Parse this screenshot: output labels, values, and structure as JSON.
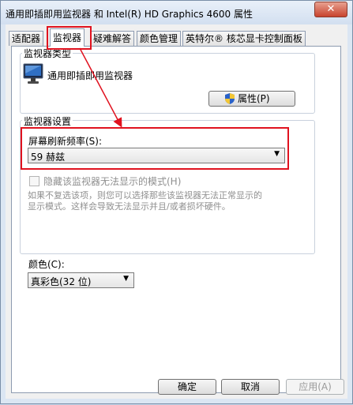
{
  "window": {
    "title": "通用即插即用监视器 和 Intel(R) HD Graphics 4600 属性",
    "close_glyph": "✕"
  },
  "tabs": [
    {
      "label": "适配器"
    },
    {
      "label": "监视器"
    },
    {
      "label": "疑难解答"
    },
    {
      "label": "颜色管理"
    },
    {
      "label": "英特尔® 核芯显卡控制面板"
    }
  ],
  "monitor_type": {
    "group_label": "监视器类型",
    "name": "通用即插即用监视器",
    "properties_button": "属性(P)",
    "icons": [
      "monitor-icon",
      "uac-shield-icon"
    ]
  },
  "monitor_settings": {
    "group_label": "监视器设置",
    "refresh_label": "屏幕刷新频率(S):",
    "refresh_value": "59 赫兹",
    "hide_modes_checkbox": "隐藏该监视器无法显示的模式(H)",
    "hide_modes_checked": false,
    "help_line1": "如果不复选该项，则您可以选择那些该监视器无法正常显示的",
    "help_line2": "显示模式。这样会导致无法显示并且/或者损坏硬件。"
  },
  "color": {
    "label": "颜色(C):",
    "value": "真彩色(32 位)"
  },
  "footer": {
    "ok": "确定",
    "cancel": "取消",
    "apply": "应用(A)"
  },
  "annotation_color": "#e0121f"
}
